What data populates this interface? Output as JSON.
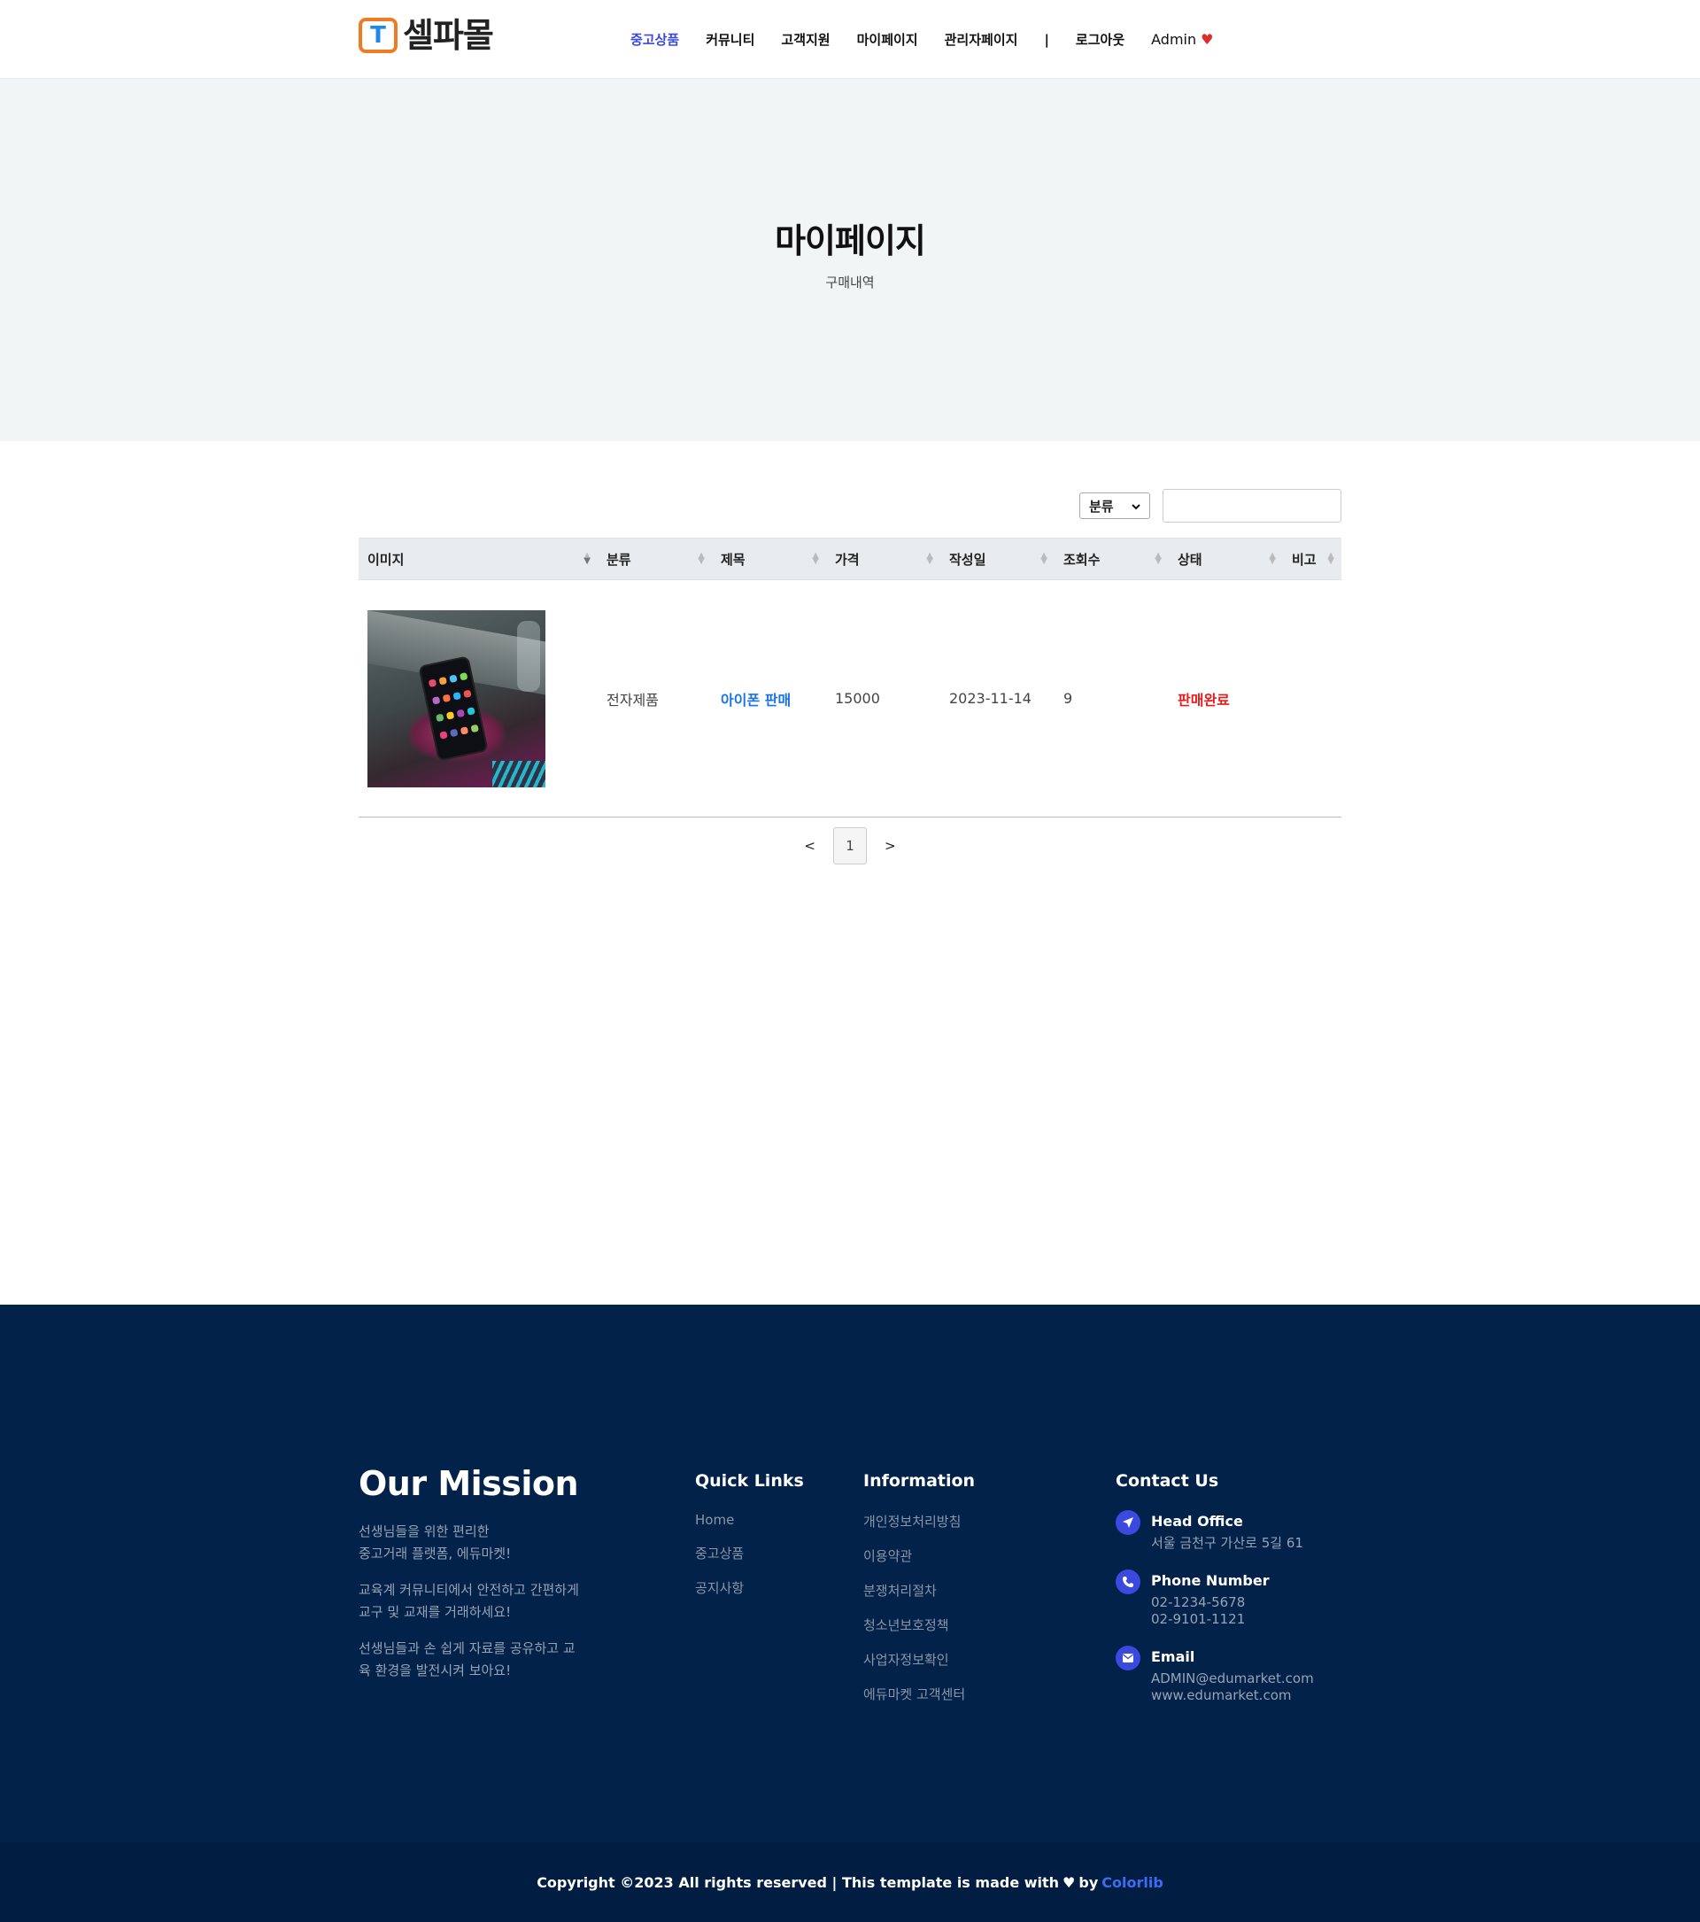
{
  "header": {
    "logo_mark": "T",
    "logo_text": "셀파몰",
    "nav": [
      "중고상품",
      "커뮤니티",
      "고객지원",
      "마이페이지",
      "관리자페이지"
    ],
    "separator": "|",
    "logout": "로그아웃",
    "admin": "Admin",
    "heart_icon": "♥",
    "active_color": "#3b49df"
  },
  "hero": {
    "title": "마이페이지",
    "subtitle": "구매내역"
  },
  "filters": {
    "select_value": "분류",
    "search_placeholder": "",
    "search_value": ""
  },
  "table": {
    "columns": [
      "이미지",
      "분류",
      "제목",
      "가격",
      "작성일",
      "조회수",
      "상태",
      "비고"
    ],
    "rows": [
      {
        "image": "phone-photo",
        "category": "전자제품",
        "title": "아이폰 판매",
        "price": "15000",
        "date": "2023-11-14",
        "views": "9",
        "status": "판매완료",
        "note": ""
      }
    ]
  },
  "pagination": {
    "prev": "<",
    "page": "1",
    "next": ">"
  },
  "footer": {
    "mission": {
      "title": "Our Mission",
      "p1_line1": "선생님들을 위한 편리한",
      "p1_line2": "중고거래 플랫폼, 에듀마켓!",
      "p2_line1": "교육계 커뮤니티에서 안전하고 간편하게",
      "p2_line2": "교구 및 교재를 거래하세요!",
      "p3_line1": "선생님들과 손 쉽게 자료를 공유하고 교",
      "p3_line2": "육 환경을 발전시켜 보아요!"
    },
    "quick_links": {
      "title": "Quick Links",
      "items": [
        "Home",
        "중고상품",
        "공지사항"
      ]
    },
    "information": {
      "title": "Information",
      "items": [
        "개인정보처리방침",
        "이용약관",
        "분쟁처리절차",
        "청소년보호정책",
        "사업자정보확인",
        "에듀마켓 고객센터"
      ]
    },
    "contact": {
      "title": "Contact Us",
      "office_head": "Head Office",
      "office_addr": "서울 금천구 가산로 5길 61",
      "phone_head": "Phone Number",
      "phone1": "02-1234-5678",
      "phone2": "02-9101-1121",
      "email_head": "Email",
      "email": "ADMIN@edumarket.com",
      "website": "www.edumarket.com"
    },
    "copyright": {
      "text_before": "Copyright ©2023 All rights reserved | This template is made with",
      "heart": "♥",
      "by": "by",
      "brand": "Colorlib"
    }
  },
  "colors": {
    "footer_bg": "#022249",
    "accent": "#3b49df",
    "status_sold": "#e51d1d",
    "title_link": "#1a73e8"
  }
}
